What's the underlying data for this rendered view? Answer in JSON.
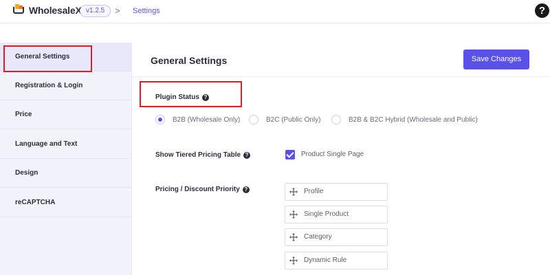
{
  "header": {
    "logo_text": "WholesaleX",
    "version": "v1.2.5",
    "separator": ">",
    "breadcrumb": "Settings",
    "help_symbol": "?"
  },
  "sidebar": {
    "items": [
      {
        "label": "General Settings",
        "active": true
      },
      {
        "label": "Registration & Login"
      },
      {
        "label": "Price"
      },
      {
        "label": "Language and Text"
      },
      {
        "label": "Design"
      },
      {
        "label": "reCAPTCHA"
      }
    ]
  },
  "main": {
    "title": "General Settings",
    "save_label": "Save Changes",
    "plugin_status": {
      "label": "Plugin Status",
      "options": [
        {
          "label": "B2B (Wholesale Only)",
          "selected": true
        },
        {
          "label": "B2C (Public Only)",
          "selected": false
        },
        {
          "label": "B2B & B2C Hybrid (Wholesale and Public)",
          "selected": false
        }
      ]
    },
    "tiered_pricing": {
      "label": "Show Tiered Pricing Table",
      "checkbox_label": "Product Single Page",
      "checked": true
    },
    "priority": {
      "label": "Pricing / Discount Priority",
      "items": [
        "Profile",
        "Single Product",
        "Category",
        "Dynamic Rule"
      ]
    }
  },
  "colors": {
    "accent": "#5a52e8",
    "highlight_box": "#e01b24",
    "sidebar_bg": "#f2f2fb"
  },
  "icons": {
    "help": "help-circle-icon",
    "tooltip": "question-circle-icon",
    "drag": "move-arrows-icon"
  }
}
